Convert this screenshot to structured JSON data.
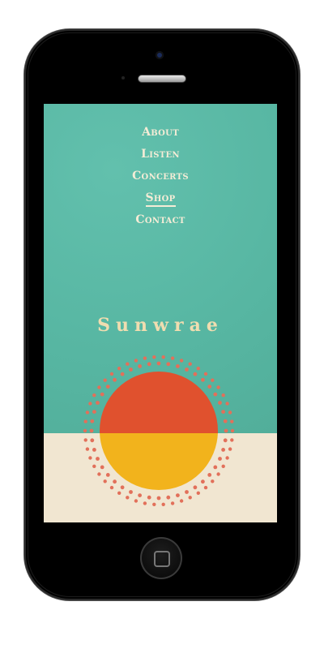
{
  "nav": {
    "items": [
      {
        "label": "About",
        "active": false
      },
      {
        "label": "Listen",
        "active": false
      },
      {
        "label": "Concerts",
        "active": false
      },
      {
        "label": "Shop",
        "active": true
      },
      {
        "label": "Contact",
        "active": false
      }
    ]
  },
  "brand": {
    "name": "Sunwrae"
  },
  "colors": {
    "sky": "#58b8a4",
    "sand": "#f1e6d1",
    "sun_top": "#e0512e",
    "sun_bottom": "#f2b31c",
    "dots": "#e2705a",
    "nav_text": "#f4ecd6",
    "brand_text": "#f0ddb0"
  },
  "device": {
    "camera": "front-camera-icon",
    "speaker": "earpiece-icon",
    "home_button": "home-button-icon"
  }
}
